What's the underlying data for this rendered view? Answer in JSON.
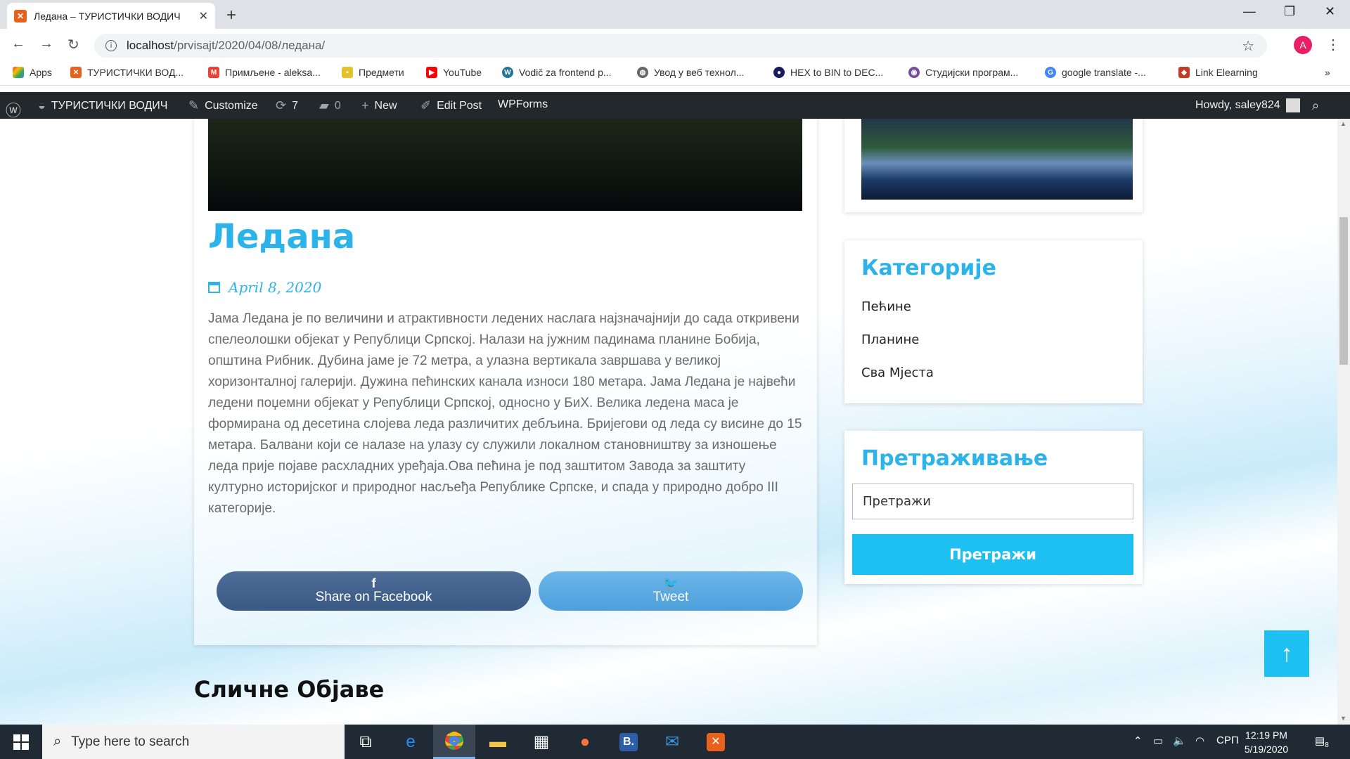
{
  "browser": {
    "tab_title": "Ледана – ТУРИСТИЧКИ ВОДИЧ",
    "tab_favicon": "xampp-icon",
    "url_host": "localhost",
    "url_path": "/prvisajt/2020/04/08/ледана/",
    "profile_initial": "A",
    "bookmarks": [
      "Apps",
      "ТУРИСТИЧКИ ВОД...",
      "Примљене - aleksa...",
      "Предмети",
      "YouTube",
      "Vodič za frontend p...",
      "Увод у веб технол...",
      "HEX to BIN to DEC...",
      "Студијски програм...",
      "google translate -...",
      "Link Elearning"
    ],
    "more_bookmarks": "»"
  },
  "adminbar": {
    "site_name": "ТУРИСТИЧКИ ВОДИЧ",
    "customize": "Customize",
    "updates_count": "7",
    "comments_count": "0",
    "new": "New",
    "edit_post": "Edit Post",
    "wpforms": "WPForms",
    "howdy": "Howdy, saley824"
  },
  "post": {
    "title": "Ледана",
    "date": "April 8, 2020",
    "body": "Јама Ледана је по величини и атрактивности ледених наслага најзначајнији до сада откривени спелеолошки објекат у Републици Српској. Налази на јужним падинама планине Бобија, општина Рибник. Дубина јаме је 72 метра, а улазна вертикала завршава у великој хоризонталној галерији. Дужина пећинских канала износи 180 метара. Јама Ледана је највећи ледени поџемни објекат у Републици Српској, односно у БиХ. Велика ледена маса је формирана од десетина слојева леда различитих дебљина. Бријегови од леда су висине до 15 метара. Балвани који се налазе на улазу су служили локалном становништву за изношење леда прије појаве расхладних уређаја.Ова пећина је под заштитом Завода за заштиту културно историјског и природног насљеђа Републике Српске, и спада у природно добро III категорије.",
    "share_facebook": "Share on Facebook",
    "share_twitter": "Tweet",
    "facebook_glyph": "f",
    "related_heading": "Сличне Објаве"
  },
  "sidebar": {
    "categories_title": "Категорије",
    "categories": [
      "Пећине",
      "Планине",
      "Сва Мјеста"
    ],
    "search_title": "Претраживање",
    "search_placeholder": "Претражи",
    "search_button": "Претражи"
  },
  "taskbar": {
    "search_placeholder": "Type here to search",
    "time": "12:19 PM",
    "date": "5/19/2020",
    "language": "СРП",
    "notifications": "8"
  },
  "colors": {
    "accent": "#2bb3ea",
    "button": "#1ec0f1",
    "facebook": "#3b5a86",
    "twitter": "#55a5e0",
    "admin_bar": "#23282d"
  }
}
